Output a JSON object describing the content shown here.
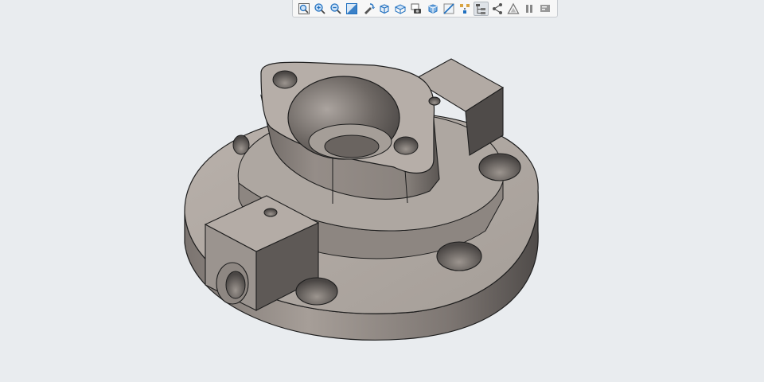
{
  "toolbar": {
    "buttons": [
      {
        "icon": "zoom-fit-icon",
        "active": false
      },
      {
        "icon": "zoom-in-icon",
        "active": false
      },
      {
        "icon": "zoom-out-icon",
        "active": false
      },
      {
        "icon": "zoom-box-icon",
        "active": false
      },
      {
        "icon": "rotate-icon",
        "active": false
      },
      {
        "icon": "view-cube-icon",
        "active": false
      },
      {
        "icon": "view-orientation-icon",
        "active": false
      },
      {
        "icon": "screenshot-icon",
        "active": false
      },
      {
        "icon": "display-style-icon",
        "active": false
      },
      {
        "icon": "section-view-icon",
        "active": false
      },
      {
        "icon": "explode-icon",
        "active": false
      },
      {
        "icon": "model-tree-icon",
        "active": true
      },
      {
        "icon": "share-icon",
        "active": false
      },
      {
        "icon": "measure-icon",
        "active": false
      },
      {
        "icon": "pause-icon",
        "active": false
      },
      {
        "icon": "presentation-icon",
        "active": false
      }
    ],
    "accent": "#1f6fbf"
  },
  "model": {
    "colors": {
      "top_face": "#b2aaa4",
      "side_light": "#8f8883",
      "side_dark": "#5a5552",
      "edge": "#1e1e1e"
    }
  }
}
